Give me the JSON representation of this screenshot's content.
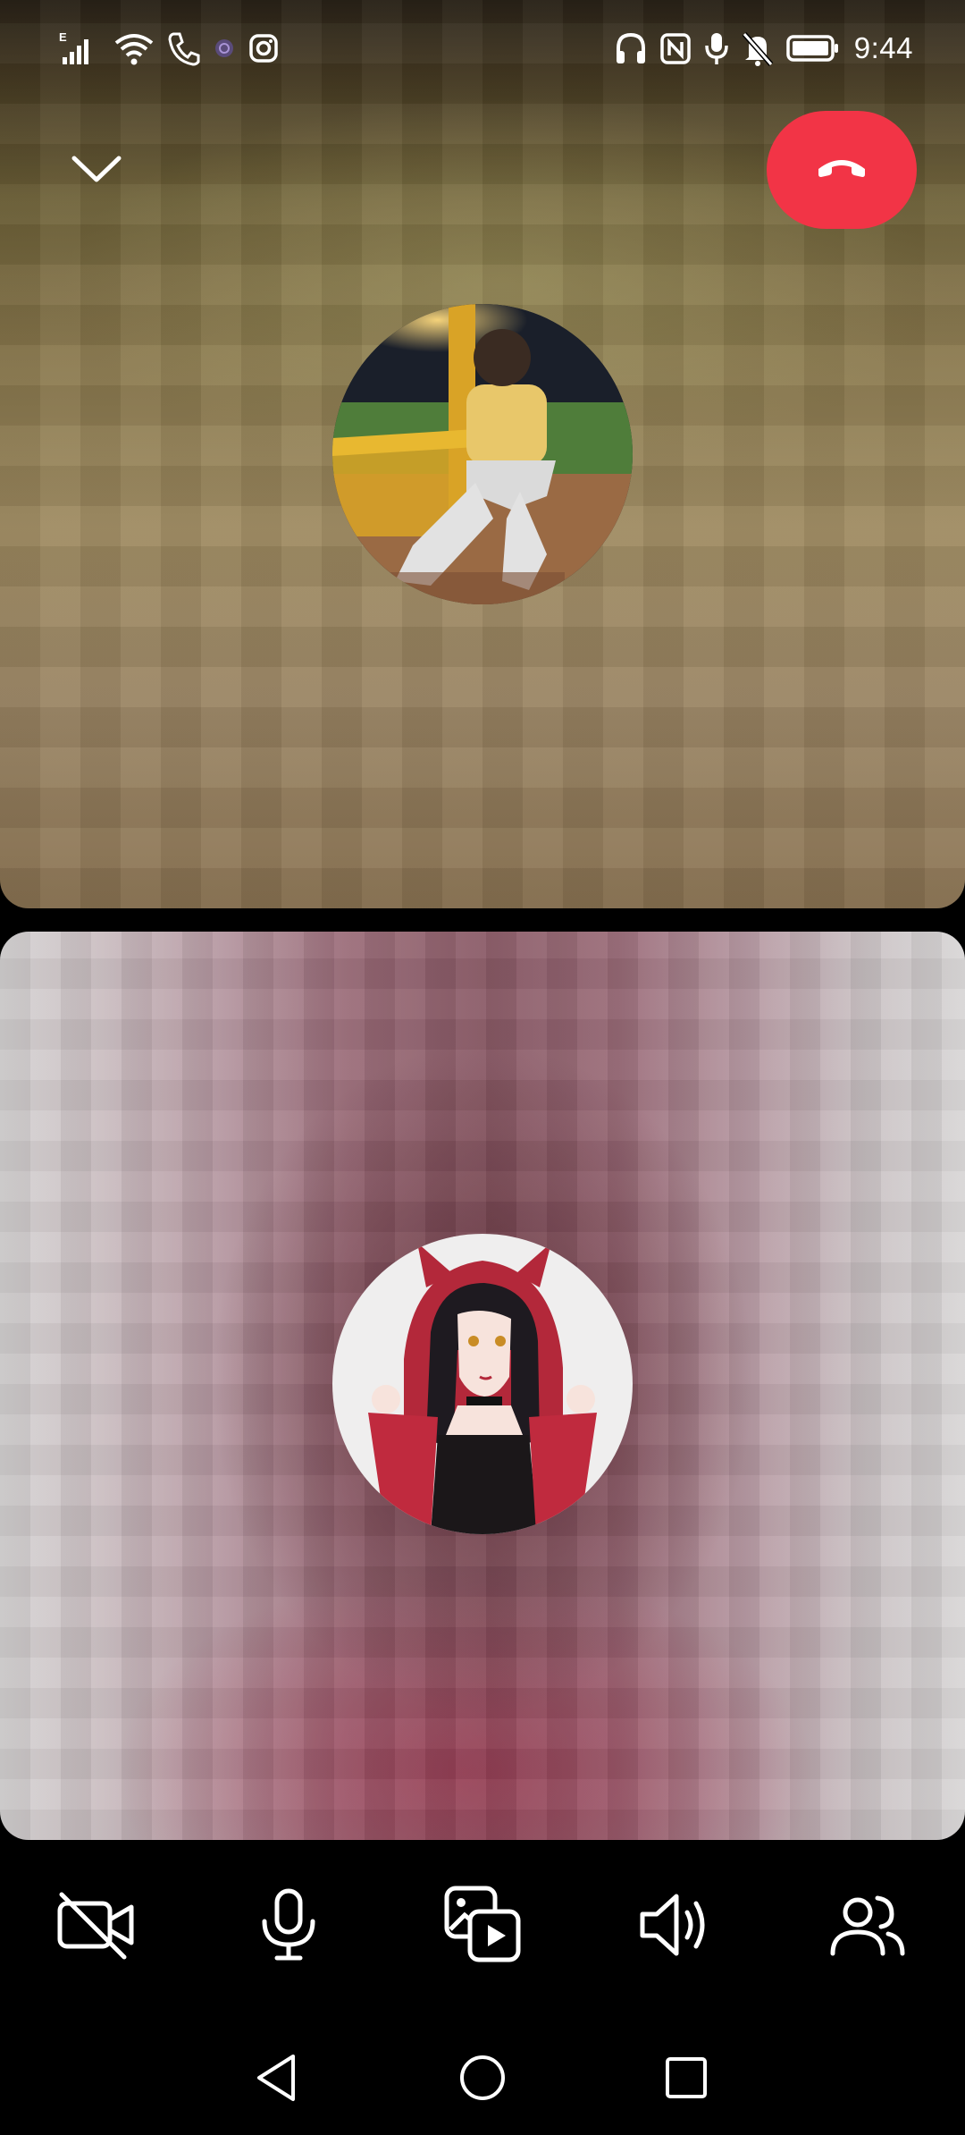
{
  "status_bar": {
    "time": "9:44",
    "network_type": "E",
    "left_icons": [
      "signal-icon",
      "wifi-icon",
      "call-icon",
      "viber-icon",
      "instagram-icon"
    ],
    "right_icons": [
      "headphones-icon",
      "nfc-icon",
      "microphone-indicator-icon",
      "notifications-muted-icon",
      "battery-icon"
    ]
  },
  "header": {
    "minimize_icon": "chevron-down-icon",
    "end_call_icon": "hang-up-icon",
    "end_call_color": "#f23446"
  },
  "participants": [
    {
      "role": "remote",
      "avatar": "profile-photo"
    },
    {
      "role": "self",
      "avatar": "anime-character-avatar"
    }
  ],
  "call_controls": [
    {
      "name": "camera-off",
      "icon": "video-off-icon"
    },
    {
      "name": "microphone",
      "icon": "microphone-icon"
    },
    {
      "name": "share-media",
      "icon": "media-share-icon"
    },
    {
      "name": "speaker",
      "icon": "speaker-icon"
    },
    {
      "name": "participants",
      "icon": "people-icon"
    }
  ],
  "nav_bar": {
    "back_icon": "back-triangle-icon",
    "home_icon": "home-circle-icon",
    "recents_icon": "recents-square-icon"
  }
}
